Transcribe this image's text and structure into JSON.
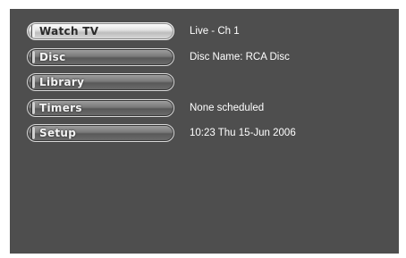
{
  "menu": {
    "items": [
      {
        "label": "Watch TV",
        "selected": true
      },
      {
        "label": "Disc",
        "selected": false
      },
      {
        "label": "Library",
        "selected": false
      },
      {
        "label": "Timers",
        "selected": false
      },
      {
        "label": "Setup",
        "selected": false
      }
    ]
  },
  "info": {
    "watch_tv_status": "Live - Ch 1",
    "disc_name": "Disc Name: RCA Disc",
    "library_status": "",
    "timers_status": "None scheduled",
    "clock": "10:23 Thu 15-Jun 2006"
  },
  "colors": {
    "background": "#4e4e4e",
    "text": "#ffffff",
    "selected_button": "#e6e6e6",
    "button": "#6d6d6d"
  }
}
